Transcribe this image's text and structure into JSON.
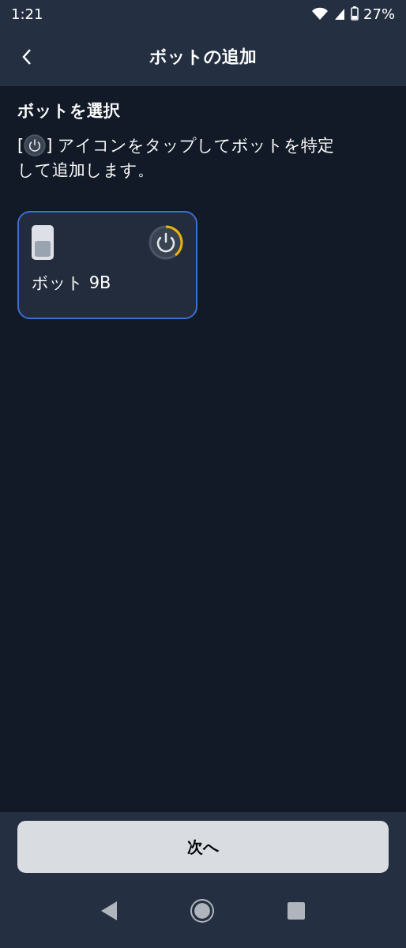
{
  "status_bar": {
    "time": "1:21",
    "battery": "27%"
  },
  "app_bar": {
    "title": "ボットの追加"
  },
  "section": {
    "heading": "ボットを選択",
    "instruction_before": "[",
    "instruction_after": "] アイコンをタップしてボットを特定",
    "instruction_line2": "して追加します。"
  },
  "devices": [
    {
      "name": "ボット 9B",
      "selected": true
    }
  ],
  "next_button": {
    "label": "次へ"
  }
}
